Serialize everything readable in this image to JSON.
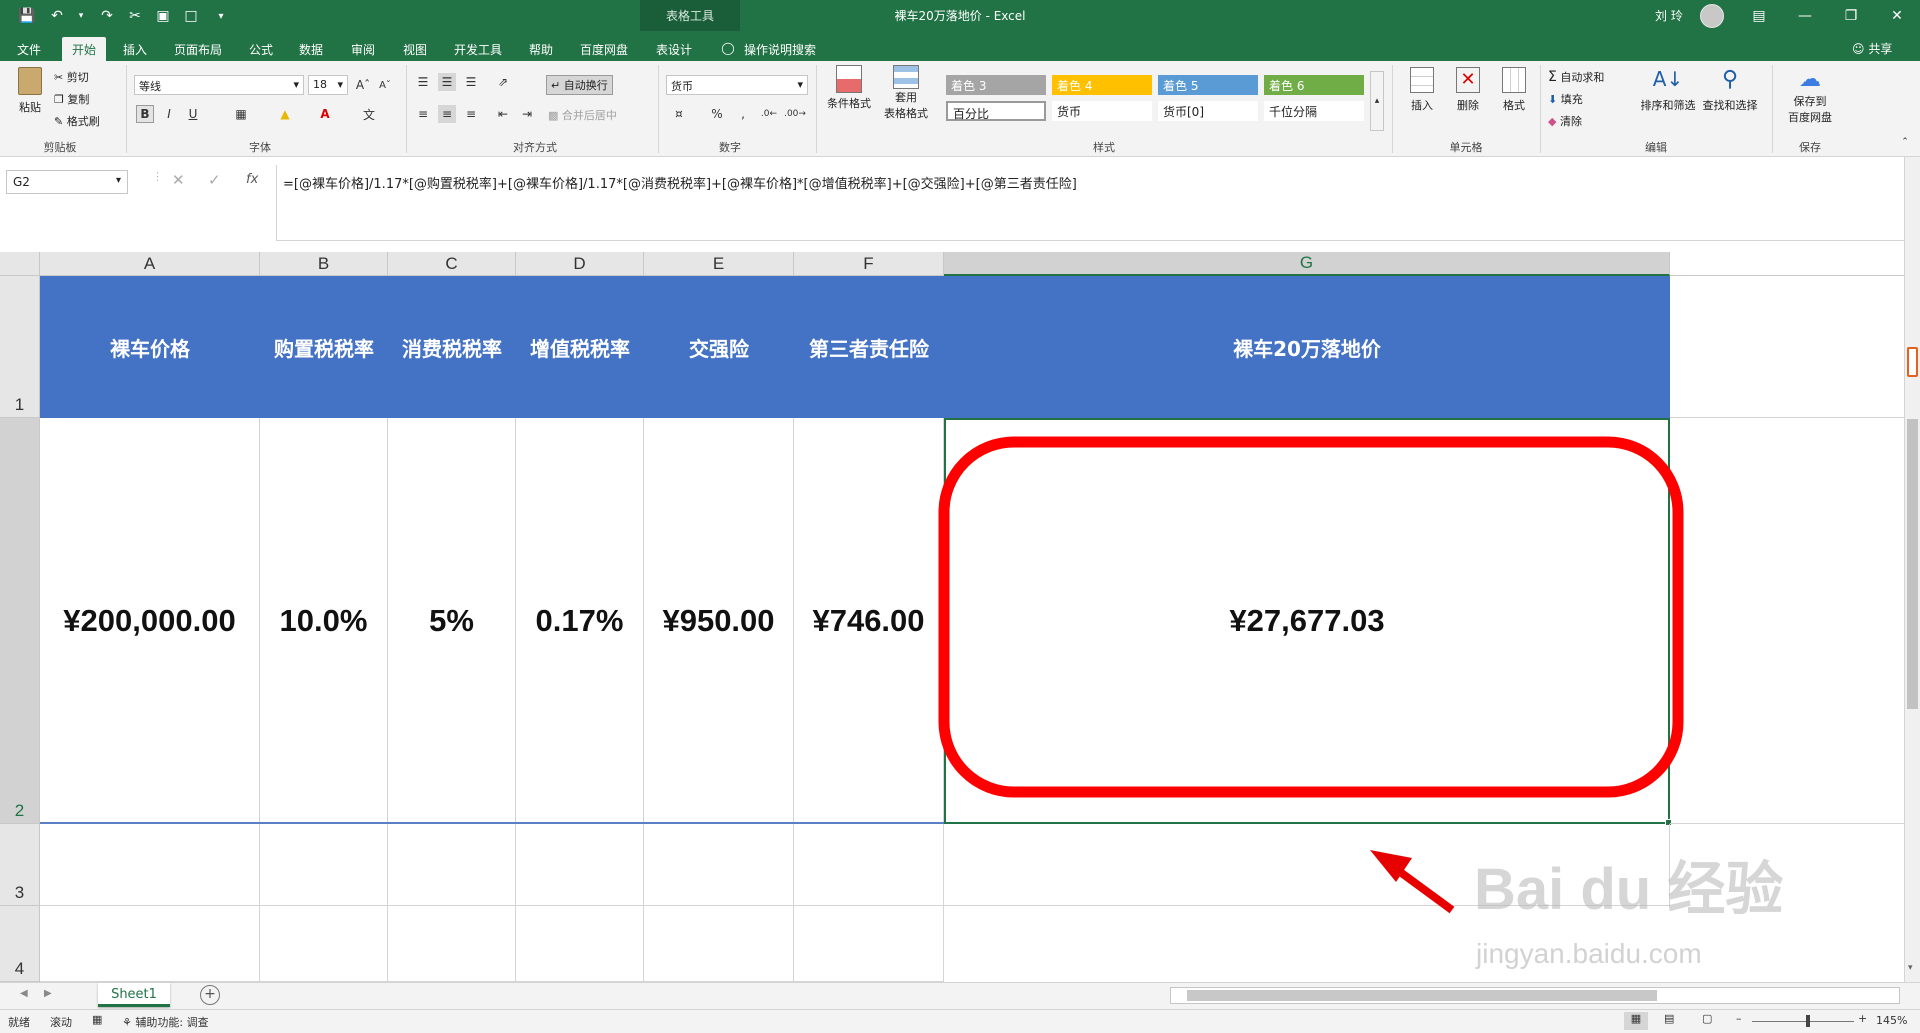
{
  "titlebar": {
    "context_tools": "表格工具",
    "title": "裸车20万落地价  -  Excel",
    "user": "刘 玲"
  },
  "tabs": [
    "文件",
    "开始",
    "插入",
    "页面布局",
    "公式",
    "数据",
    "审阅",
    "视图",
    "开发工具",
    "帮助",
    "百度网盘",
    "表设计",
    "操作说明搜索"
  ],
  "share_label": "共享",
  "ribbon": {
    "clipboard": {
      "paste": "粘贴",
      "cut": "剪切",
      "copy": "复制",
      "format_painter": "格式刷",
      "group": "剪贴板"
    },
    "font": {
      "name": "等线",
      "size": "18",
      "group": "字体",
      "bold": "B",
      "italic": "I",
      "underline": "U"
    },
    "align": {
      "wrap": "自动换行",
      "merge": "合并后居中",
      "group": "对齐方式"
    },
    "number": {
      "format": "货币",
      "percent": "%",
      "group": "数字"
    },
    "styles": {
      "conditional": "条件格式",
      "table_format_1": "套用",
      "table_format_2": "表格格式",
      "cells": [
        "着色 3",
        "着色 4",
        "着色 5",
        "着色 6",
        "百分比",
        "货币",
        "货币[0]",
        "千位分隔"
      ],
      "group": "样式"
    },
    "cells_group": {
      "insert": "插入",
      "delete": "删除",
      "format": "格式",
      "group": "单元格"
    },
    "editing": {
      "autosum": "自动求和",
      "fill": "填充",
      "clear": "清除",
      "sort": "排序和筛选",
      "find": "查找和选择",
      "group": "编辑"
    },
    "save": {
      "label_1": "保存到",
      "label_2": "百度网盘",
      "group": "保存"
    },
    "colors": {
      "accent3": "#a5a5a5",
      "accent4": "#ffc000",
      "accent5": "#5b9bd5",
      "accent6": "#70ad47"
    }
  },
  "formula_bar": {
    "name_box": "G2",
    "fx": "fx",
    "formula": "=[@裸车价格]/1.17*[@购置税税率]+[@裸车价格]/1.17*[@消费税税率]+[@裸车价格]*[@增值税税率]+[@交强险]+[@第三者责任险]"
  },
  "columns": [
    "A",
    "B",
    "C",
    "D",
    "E",
    "F",
    "G"
  ],
  "rows": [
    "1",
    "2",
    "3",
    "4"
  ],
  "table": {
    "headers": [
      "裸车价格",
      "购置税税率",
      "消费税税率",
      "增值税税率",
      "交强险",
      "第三者责任险",
      "裸车20万落地价"
    ],
    "values": [
      "¥200,000.00",
      "10.0%",
      "5%",
      "0.17%",
      "¥950.00",
      "¥746.00",
      "¥27,677.03"
    ],
    "header_color": "#4472c4"
  },
  "sheet_tab": "Sheet1",
  "status": {
    "ready": "就绪",
    "scroll": "滚动",
    "accessibility": "辅助功能: 调查",
    "zoom": "145%"
  },
  "watermark": {
    "brand": "Bai du 经验",
    "url": "jingyan.baidu.com"
  },
  "annotation_color": "#ff0000"
}
